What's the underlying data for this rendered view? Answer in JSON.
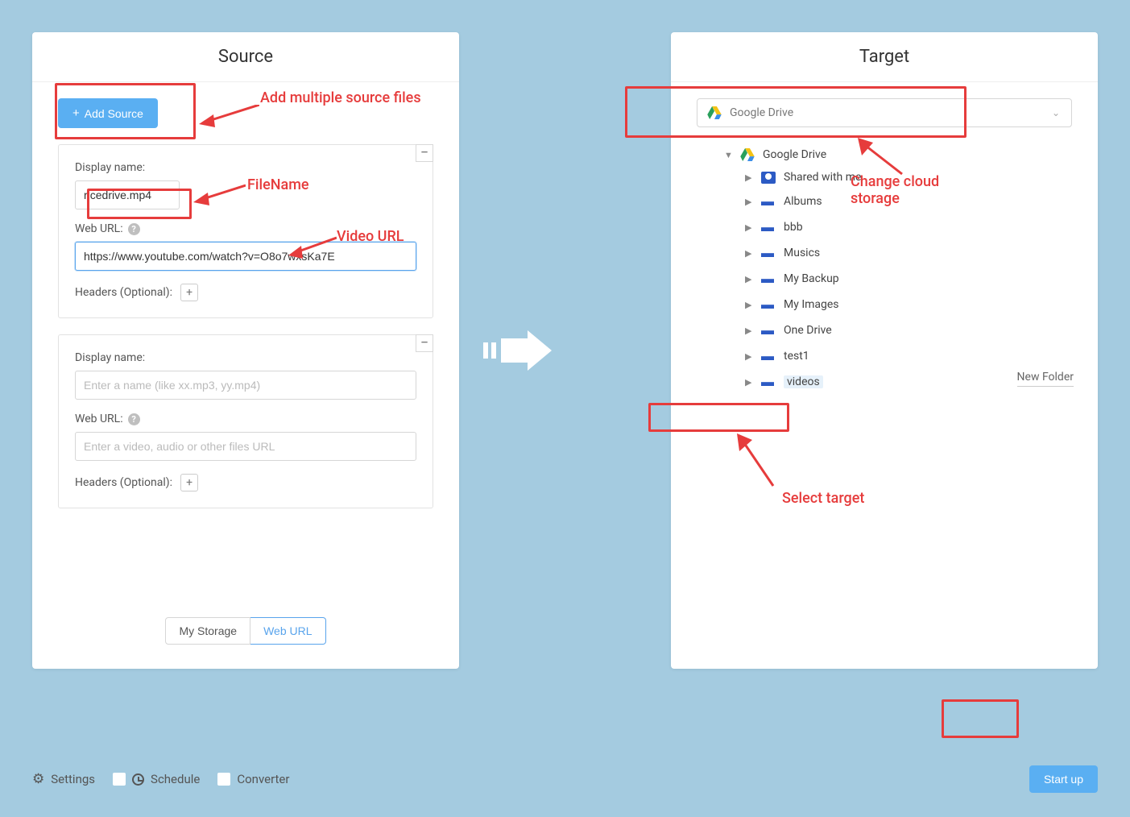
{
  "source": {
    "title": "Source",
    "add_button": "Add Source",
    "blocks": [
      {
        "display_label": "Display name:",
        "display_value": "ricedrive.mp4",
        "display_placeholder": "Enter a name (like xx.mp3, yy.mp4)",
        "url_label": "Web URL:",
        "url_value": "https://www.youtube.com/watch?v=O8o7wxsKa7E",
        "url_placeholder": "Enter a video, audio or other files URL",
        "headers_label": "Headers (Optional):"
      },
      {
        "display_label": "Display name:",
        "display_value": "",
        "display_placeholder": "Enter a name (like xx.mp3, yy.mp4)",
        "url_label": "Web URL:",
        "url_value": "",
        "url_placeholder": "Enter a video, audio or other files URL",
        "headers_label": "Headers (Optional):"
      }
    ],
    "tabs": {
      "storage": "My Storage",
      "weburl": "Web URL"
    }
  },
  "target": {
    "title": "Target",
    "select_label": "Google Drive",
    "root_label": "Google Drive",
    "folders": [
      "Shared with me",
      "Albums",
      "bbb",
      "Musics",
      "My Backup",
      "My Images",
      "One Drive",
      "test1",
      "videos"
    ],
    "new_folder": "New Folder"
  },
  "bottom": {
    "settings": "Settings",
    "schedule": "Schedule",
    "converter": "Converter",
    "start": "Start up"
  },
  "annotations": {
    "a1": "Add multiple source files",
    "a2": "FileName",
    "a3": "Video URL",
    "a4": "Change cloud storage",
    "a5": "Select target"
  }
}
